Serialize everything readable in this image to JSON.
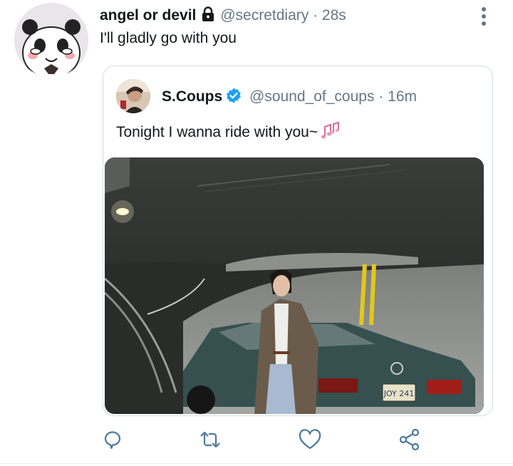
{
  "tweet": {
    "author_name": "angel or devil",
    "handle": "@secretdiary",
    "time": "· 28s",
    "text": "I'll gladly go with you"
  },
  "quoted_tweet": {
    "author_name": "S.Coups",
    "handle": "@sound_of_coups",
    "time": "· 16m",
    "text": "Tonight I wanna ride with you~",
    "license_plate": "JOY 241"
  },
  "icons": {
    "lock": "lock-icon",
    "more": "more-vertical-icon",
    "verified": "verified-badge-icon",
    "music": "music-notes-emoji",
    "reply": "reply-icon",
    "retweet": "retweet-icon",
    "like": "heart-icon",
    "share": "share-icon"
  },
  "colors": {
    "accent": "#1da1f2",
    "muted": "#657786",
    "icon": "#4a7a9a",
    "text": "#14171a"
  }
}
